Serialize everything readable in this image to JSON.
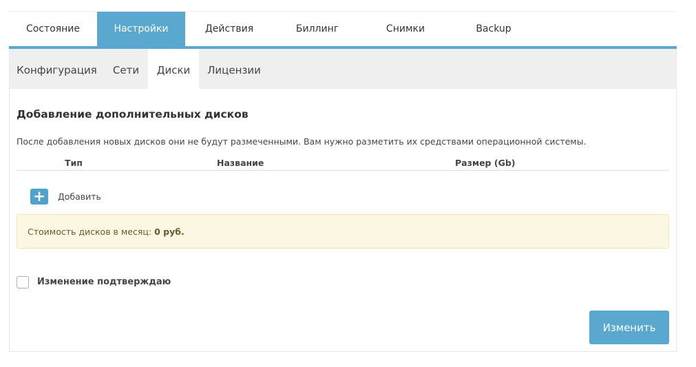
{
  "tabs": [
    {
      "label": "Состояние",
      "active": false
    },
    {
      "label": "Настройки",
      "active": true
    },
    {
      "label": "Действия",
      "active": false
    },
    {
      "label": "Биллинг",
      "active": false
    },
    {
      "label": "Снимки",
      "active": false
    },
    {
      "label": "Backup",
      "active": false
    }
  ],
  "subtabs": [
    {
      "label": "Конфигурация",
      "active": false
    },
    {
      "label": "Сети",
      "active": false
    },
    {
      "label": "Диски",
      "active": true
    },
    {
      "label": "Лицензии",
      "active": false
    }
  ],
  "section": {
    "title": "Добавление дополнительных дисков",
    "note": "После добавления новых дисков они не будут размеченными. Вам нужно разметить их средствами операционной системы."
  },
  "table": {
    "columns": [
      "Тип",
      "Название",
      "Размер (Gb)"
    ]
  },
  "add": {
    "label": "Добавить",
    "icon": "plus-icon"
  },
  "cost": {
    "label": "Стоимость дисков в месяц:",
    "value": "0 руб."
  },
  "confirm": {
    "label": "Изменение подтверждаю",
    "checked": false
  },
  "submit": {
    "label": "Изменить"
  },
  "colors": {
    "accent": "#5aa7cf",
    "cost_bg": "#fcf7e3"
  }
}
